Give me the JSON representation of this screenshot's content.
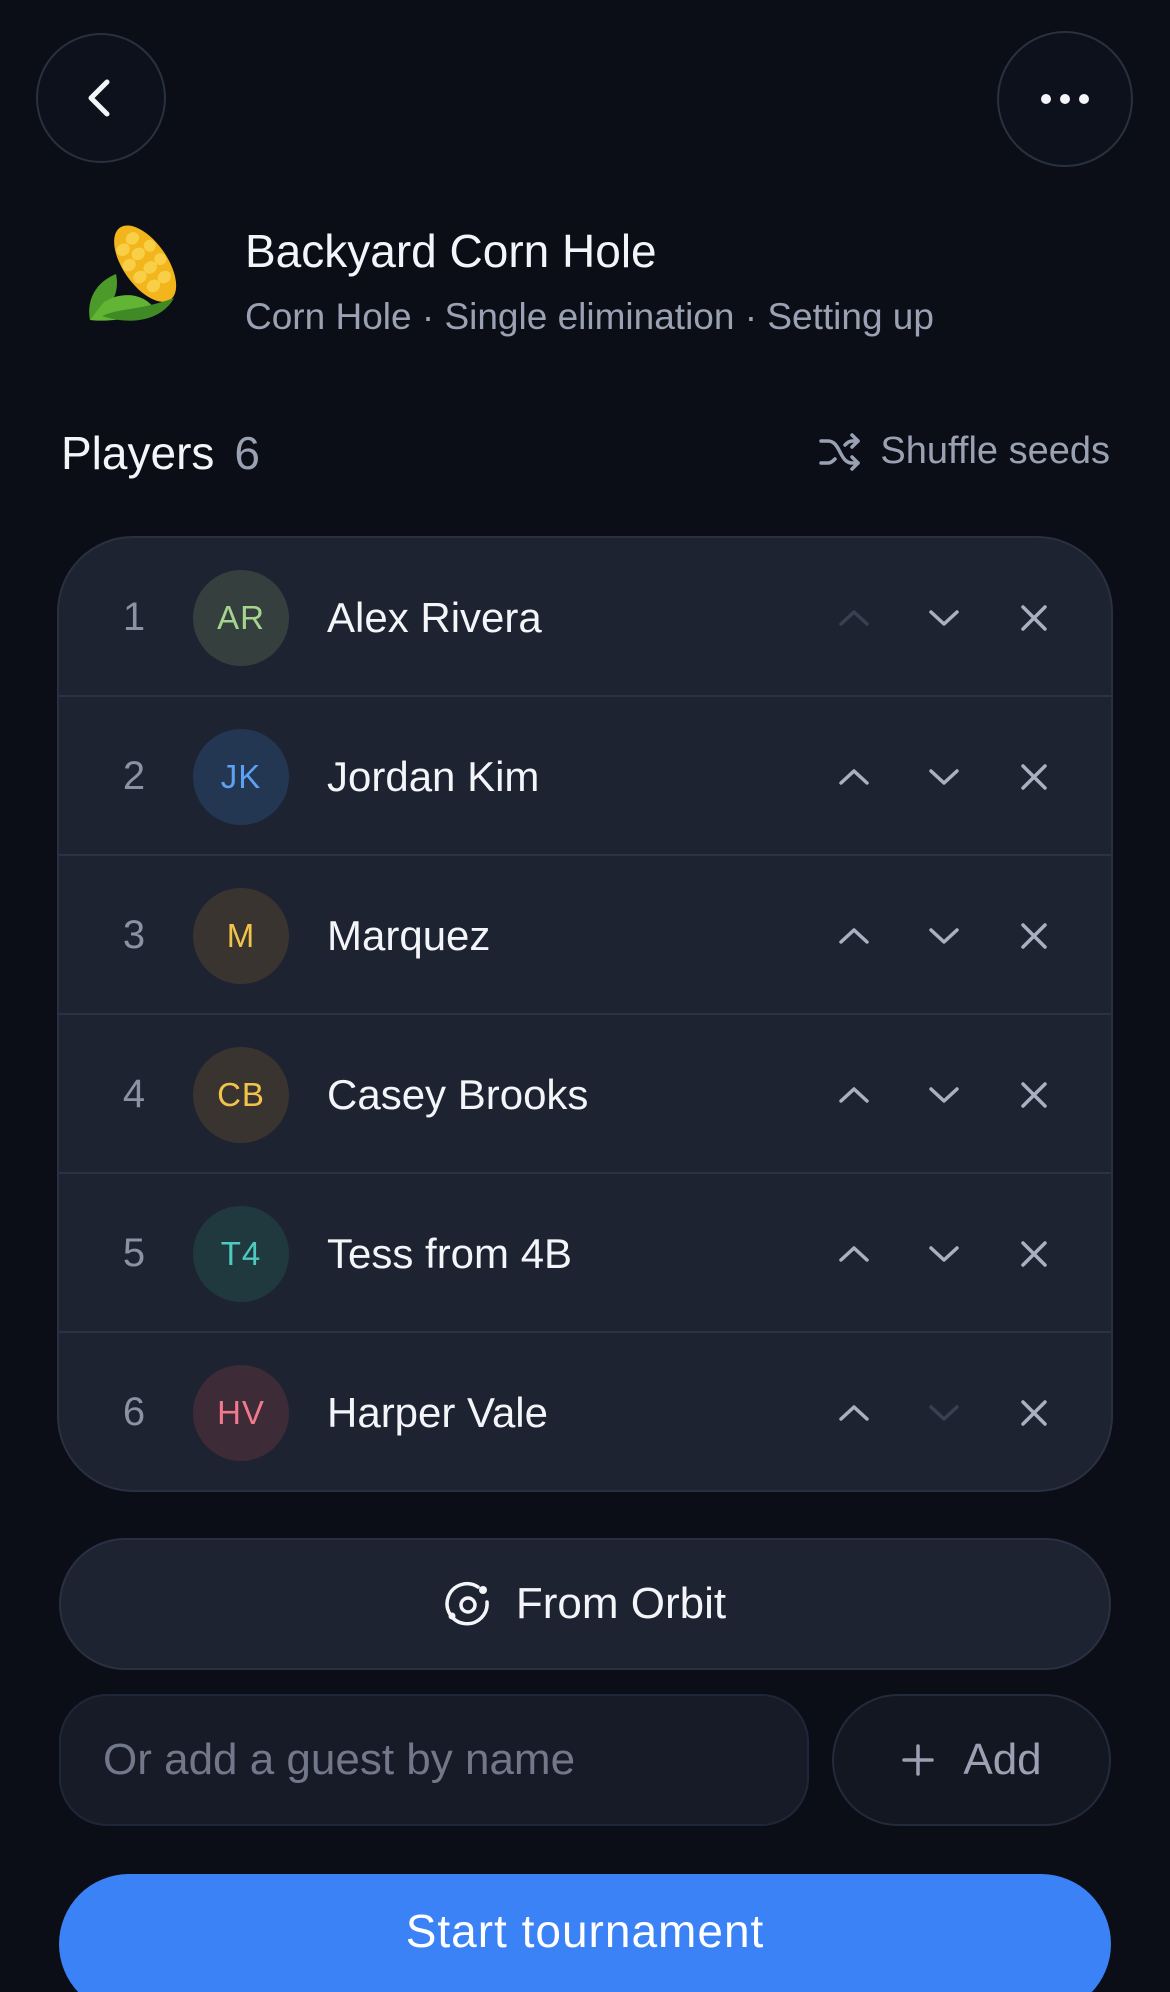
{
  "header": {
    "back_icon": "chevron-left-icon",
    "more_icon": "more-horizontal-icon",
    "tournament_icon": "corn-emoji",
    "title": "Backyard Corn Hole",
    "subtitle": "Corn Hole · Single elimination · Setting up"
  },
  "players": {
    "heading": "Players",
    "count": "6",
    "shuffle_label": "Shuffle seeds",
    "list": [
      {
        "seed": "1",
        "initials": "AR",
        "name": "Alex Rivera",
        "avatar_bg": "#353f3d",
        "avatar_fg": "#a4d490",
        "up_enabled": false,
        "down_enabled": true
      },
      {
        "seed": "2",
        "initials": "JK",
        "name": "Jordan Kim",
        "avatar_bg": "#233752",
        "avatar_fg": "#5fa0f0",
        "up_enabled": true,
        "down_enabled": true
      },
      {
        "seed": "3",
        "initials": "M",
        "name": "Marquez",
        "avatar_bg": "#3a3430",
        "avatar_fg": "#f2c34b",
        "up_enabled": true,
        "down_enabled": true
      },
      {
        "seed": "4",
        "initials": "CB",
        "name": "Casey Brooks",
        "avatar_bg": "#3a3430",
        "avatar_fg": "#f2c34b",
        "up_enabled": true,
        "down_enabled": true
      },
      {
        "seed": "5",
        "initials": "T4",
        "name": "Tess from 4B",
        "avatar_bg": "#20393f",
        "avatar_fg": "#4fc9c0",
        "up_enabled": true,
        "down_enabled": true
      },
      {
        "seed": "6",
        "initials": "HV",
        "name": "Harper Vale",
        "avatar_bg": "#3d2b37",
        "avatar_fg": "#f07a8c",
        "up_enabled": true,
        "down_enabled": false
      }
    ]
  },
  "actions": {
    "orbit_label": "From Orbit",
    "guest_placeholder": "Or add a guest by name",
    "add_label": "Add",
    "start_label": "Start tournament"
  },
  "colors": {
    "background": "#0b0e17",
    "card": "#1e2332",
    "accent": "#3b82f6",
    "muted_text": "#9aa1b2"
  }
}
